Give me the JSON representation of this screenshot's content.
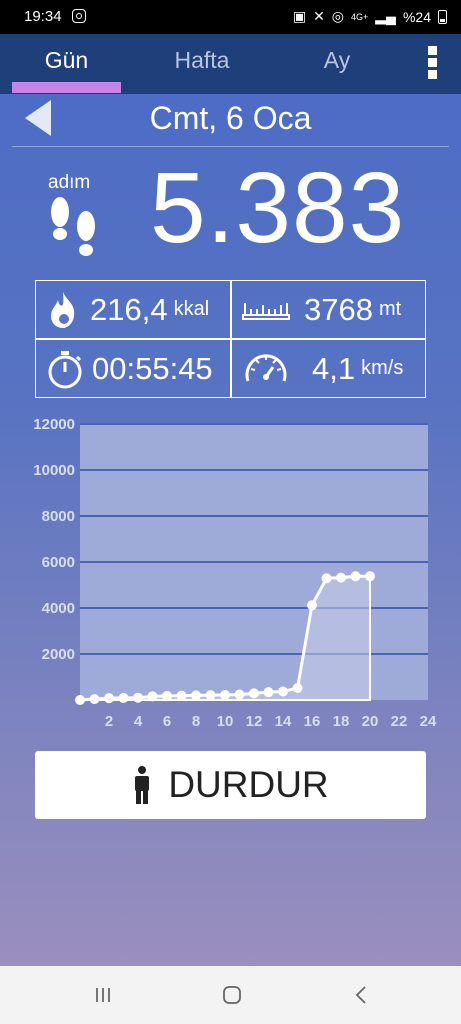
{
  "status_bar": {
    "time": "19:34",
    "signal_label": "4G+",
    "battery_text": "%24"
  },
  "tabs": [
    {
      "label": "Gün",
      "active": true
    },
    {
      "label": "Hafta",
      "active": false
    },
    {
      "label": "Ay",
      "active": false
    }
  ],
  "header": {
    "date": "Cmt, 6 Oca"
  },
  "steps": {
    "label": "adım",
    "count": "5.383"
  },
  "stats": {
    "calories": {
      "value": "216,4",
      "unit": "kkal",
      "icon": "flame-icon"
    },
    "distance": {
      "value": "3768",
      "unit": "mt",
      "icon": "ruler-icon"
    },
    "duration": {
      "value": "00:55:45",
      "icon": "stopwatch-icon"
    },
    "speed": {
      "value": "4,1",
      "unit": "km/s",
      "icon": "speedometer-icon"
    }
  },
  "chart_data": {
    "type": "area",
    "x": [
      0,
      1,
      2,
      3,
      4,
      5,
      6,
      7,
      8,
      9,
      10,
      11,
      12,
      13,
      14,
      15,
      16,
      17,
      18,
      19,
      20
    ],
    "values": [
      0,
      40,
      80,
      90,
      100,
      160,
      180,
      190,
      200,
      210,
      220,
      240,
      290,
      340,
      370,
      520,
      4120,
      5290,
      5320,
      5380,
      5383
    ],
    "xticks": [
      2,
      4,
      6,
      8,
      10,
      12,
      14,
      16,
      18,
      20,
      22,
      24
    ],
    "yticks": [
      2000,
      4000,
      6000,
      8000,
      10000,
      12000
    ],
    "xlim": [
      0,
      24
    ],
    "ylim": [
      0,
      12000
    ],
    "grid": true,
    "colors": {
      "line": "#ffffff",
      "fill": "#c9cde8",
      "plot_bg": "#9eaad8",
      "grid": "#4a64b4",
      "tick": "#d9def2"
    }
  },
  "stop_button": {
    "label": "DURDUR",
    "icon": "person-icon"
  },
  "nav": {
    "recents": "recents-icon",
    "home": "home-icon",
    "back": "back-icon"
  }
}
